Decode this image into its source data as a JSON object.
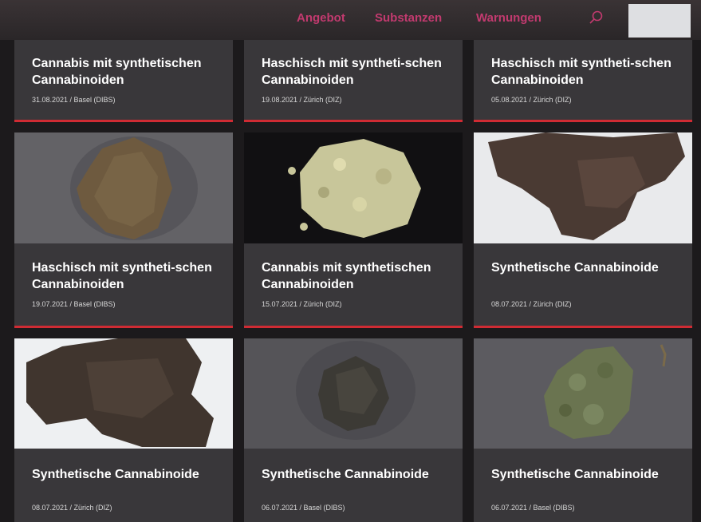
{
  "nav": {
    "items": [
      "Angebot",
      "Substanzen",
      "Warnungen"
    ]
  },
  "cards": [
    {
      "title": "Cannabis mit synthetischen Cannabinoiden",
      "meta": "31.08.2021 / Basel (DIBS)"
    },
    {
      "title": "Haschisch mit syntheti-schen Cannabinoiden",
      "meta": "19.08.2021 / Zürich (DIZ)"
    },
    {
      "title": "Haschisch mit syntheti-schen Cannabinoiden",
      "meta": "05.08.2021 / Zürich (DIZ)"
    },
    {
      "title": "Haschisch mit syntheti-schen Cannabinoiden",
      "meta": "19.07.2021 / Basel (DIBS)"
    },
    {
      "title": "Cannabis mit synthetischen Cannabinoiden",
      "meta": "15.07.2021 / Zürich (DIZ)"
    },
    {
      "title": "Synthetische Cannabinoide",
      "meta": "08.07.2021 / Zürich (DIZ)"
    },
    {
      "title": "Synthetische Cannabinoide",
      "meta": "08.07.2021 / Zürich (DIZ)"
    },
    {
      "title": "Synthetische Cannabinoide",
      "meta": "06.07.2021 / Basel (DIBS)"
    },
    {
      "title": "Synthetische Cannabinoide",
      "meta": "06.07.2021 / Basel (DIBS)"
    }
  ],
  "colors": {
    "accent": "#cf2b33",
    "nav": "#c23a6f",
    "card": "#39373a"
  }
}
